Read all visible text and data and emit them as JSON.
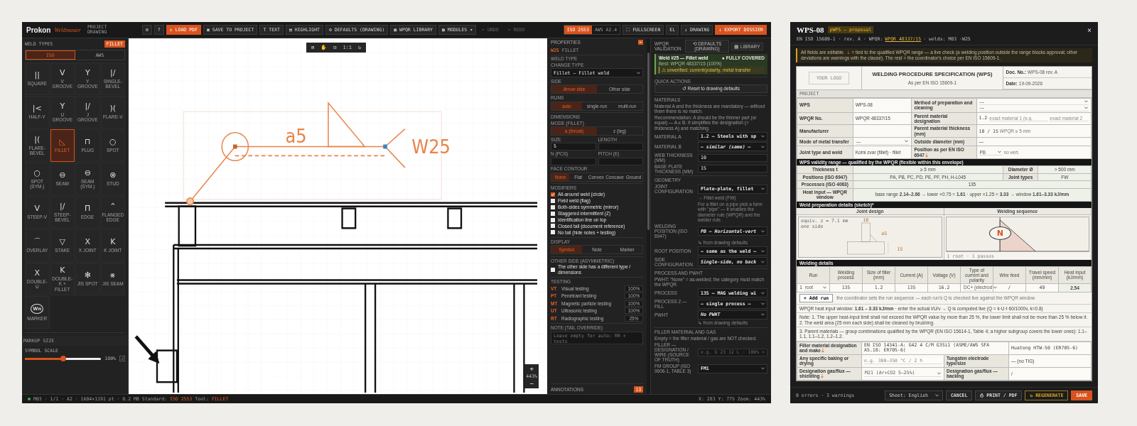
{
  "toolbar": {
    "brand": "Prokon",
    "product": "Weldmaster",
    "project_lines": [
      "PROJECT",
      "DRAWING"
    ],
    "buttons": [
      {
        "label": "⚙",
        "kind": "plain",
        "disabled": false
      },
      {
        "label": "?",
        "kind": "plain",
        "disabled": false
      },
      {
        "label": "↥ LOAD PDF",
        "kind": "accent",
        "disabled": false
      },
      {
        "label": "▣ SAVE TO PROJECT",
        "kind": "plain",
        "disabled": false
      },
      {
        "label": "T TEXT",
        "kind": "plain",
        "disabled": false
      },
      {
        "label": "▤ HIGHLIGHT",
        "kind": "plain",
        "disabled": false
      },
      {
        "label": "⚙ DEFAULTS (DRAWING)",
        "kind": "plain",
        "disabled": false
      },
      {
        "label": "▦ WPQR LIBRARY",
        "kind": "plain",
        "disabled": false
      },
      {
        "label": "▦ MODULES ▾",
        "kind": "plain",
        "disabled": false
      },
      {
        "label": "↶ UNDO",
        "kind": "plain",
        "disabled": true
      },
      {
        "label": "↷ REDO",
        "kind": "plain",
        "disabled": true
      }
    ],
    "standards": [
      {
        "label": "ISO 2553",
        "selected": true
      },
      {
        "label": "AWS A2.4",
        "selected": false
      }
    ],
    "right_buttons": [
      {
        "label": "⛶ FULLSCREEN",
        "kind": "plain"
      },
      {
        "label": "EL",
        "kind": "plain"
      },
      {
        "label": "↓ DRAWING",
        "kind": "plain"
      },
      {
        "label": "↓ EXPORT DOSSIER",
        "kind": "accent"
      }
    ]
  },
  "weld_types": {
    "title": "WELD TYPES",
    "badge": "FILLET",
    "tabs": [
      {
        "label": "ISO",
        "selected": true
      },
      {
        "label": "AWS",
        "selected": false
      }
    ],
    "items": [
      {
        "symbol": "||",
        "label": "SQUARE",
        "selected": false
      },
      {
        "symbol": "V",
        "label": "V GROOVE",
        "selected": false
      },
      {
        "symbol": "Y",
        "label": "Y GROOVE",
        "selected": false
      },
      {
        "symbol": "|/",
        "label": "SINGLE-BEVEL",
        "selected": false
      },
      {
        "symbol": "|<",
        "label": "HALF-Y",
        "selected": false
      },
      {
        "symbol": "Y",
        "label": "U GROOVE",
        "selected": false
      },
      {
        "symbol": "|/",
        "label": "J GROOVE",
        "selected": false
      },
      {
        "symbol": ")(",
        "label": "FLARE-V",
        "selected": false
      },
      {
        "symbol": "|(",
        "label": "FLARE-BEVEL",
        "selected": false
      },
      {
        "symbol": "◺",
        "label": "FILLET",
        "selected": true
      },
      {
        "symbol": "⊓",
        "label": "PLUG",
        "selected": false
      },
      {
        "symbol": "○",
        "label": "SPOT",
        "selected": false
      },
      {
        "symbol": "○",
        "label": "SPOT (SYM.)",
        "selected": false
      },
      {
        "symbol": "⊖",
        "label": "SEAM",
        "selected": false
      },
      {
        "symbol": "⊖",
        "label": "SEAM (SYM.)",
        "selected": false
      },
      {
        "symbol": "⊗",
        "label": "STUD",
        "selected": false
      },
      {
        "symbol": "V",
        "label": "STEEP-V",
        "selected": false
      },
      {
        "symbol": "|/",
        "label": "STEEP-BEVEL",
        "selected": false
      },
      {
        "symbol": "Π",
        "label": "EDGE",
        "selected": false
      },
      {
        "symbol": "⌃",
        "label": "FLANGED EDGE",
        "selected": false
      },
      {
        "symbol": "⌒",
        "label": "OVERLAY",
        "selected": false
      },
      {
        "symbol": "▽",
        "label": "STAKE",
        "selected": false
      },
      {
        "symbol": "X",
        "label": "X JOINT",
        "selected": false
      },
      {
        "symbol": "K",
        "label": "K JOINT",
        "selected": false
      },
      {
        "symbol": "X",
        "label": "DOUBLE-U",
        "selected": false
      },
      {
        "symbol": "K",
        "label": "DOUBLE-K + FILLET",
        "selected": false
      },
      {
        "symbol": "✻",
        "label": "JIS SPOT",
        "selected": false
      },
      {
        "symbol": "⨳",
        "label": "JIS SEAM",
        "selected": false
      },
      {
        "symbol": "Wn",
        "label": "MARKER",
        "selected": false
      }
    ],
    "markup": {
      "title": "MARKUP SIZE",
      "label": "SYMBOL SCALE",
      "level": 0.5,
      "reading": "100%"
    }
  },
  "canvas": {
    "tools": [
      "⊞",
      "✋",
      "⊡",
      "1:1",
      "↻"
    ],
    "throat": "a5",
    "weld_id": "W25",
    "zoom": [
      "+",
      "443%",
      "−"
    ]
  },
  "properties": {
    "title": "PROPERTIES",
    "weld_id": "W25",
    "weld_type": "FILLET",
    "items": [
      {
        "kind": "label",
        "text": "WELD TYPE"
      },
      {
        "kind": "label",
        "text": "CHANGE TYPE"
      },
      {
        "kind": "select",
        "value": "Fillet — Fillet weld"
      },
      {
        "kind": "label",
        "text": "SIDE"
      },
      {
        "kind": "segmented",
        "options": [
          {
            "label": "Arrow side",
            "selected": true
          },
          {
            "label": "Other side",
            "selected": false
          }
        ]
      },
      {
        "kind": "label",
        "text": "RUNS"
      },
      {
        "kind": "segmented",
        "options": [
          {
            "label": "auto",
            "selected": true
          },
          {
            "label": "single-run",
            "selected": false
          },
          {
            "label": "multi-run",
            "selected": false
          }
        ]
      },
      {
        "kind": "heading",
        "text": "DIMENSIONS"
      },
      {
        "kind": "label",
        "text": "MODE (FILLET)"
      },
      {
        "kind": "segmented",
        "options": [
          {
            "label": "a (throat)",
            "selected": true
          },
          {
            "label": "z (leg)",
            "selected": false
          }
        ]
      },
      {
        "kind": "fields",
        "fields": [
          {
            "label": "SIZE",
            "value": "5"
          },
          {
            "label": "LENGTH"
          }
        ]
      },
      {
        "kind": "fields",
        "fields": [
          {
            "label": "N (PCS)"
          },
          {
            "label": "PITCH (E)"
          }
        ]
      },
      {
        "kind": "label",
        "text": "FACE CONTOUR"
      },
      {
        "kind": "segmented",
        "options": [
          {
            "label": "None",
            "selected": true
          },
          {
            "label": "Flat",
            "selected": false
          },
          {
            "label": "Convex",
            "selected": false
          },
          {
            "label": "Concave",
            "selected": false
          },
          {
            "label": "Ground",
            "selected": false
          }
        ]
      },
      {
        "kind": "heading",
        "text": "MODIFIERS"
      },
      {
        "kind": "checkbox",
        "label": "All-around weld (circle)",
        "checked": true
      },
      {
        "kind": "checkbox",
        "label": "Field weld (flag)",
        "checked": false
      },
      {
        "kind": "checkbox",
        "label": "Both-sides symmetric (mirror)",
        "checked": false
      },
      {
        "kind": "checkbox",
        "label": "Staggered intermittent (Z)",
        "checked": false
      },
      {
        "kind": "checkbox",
        "label": "Identification line on top",
        "checked": false
      },
      {
        "kind": "checkbox",
        "label": "Closed tail (document reference)",
        "checked": false
      },
      {
        "kind": "checkbox",
        "label": "No tail (hide notes + testing)",
        "checked": false
      },
      {
        "kind": "heading",
        "text": "DISPLAY"
      },
      {
        "kind": "segmented",
        "options": [
          {
            "label": "Symbol",
            "selected": true
          },
          {
            "label": "Note",
            "selected": false
          },
          {
            "label": "Marker",
            "selected": false
          }
        ]
      },
      {
        "kind": "heading",
        "text": "OTHER SIDE (ASYMMETRIC)"
      },
      {
        "kind": "checkbox",
        "label": "The other side has a different type / dimensions",
        "checked": false
      },
      {
        "kind": "heading",
        "text": "TESTING"
      },
      {
        "kind": "test",
        "code": "VT",
        "label": "Visual testing",
        "value": "100%"
      },
      {
        "kind": "test",
        "code": "PT",
        "label": "Penetrant testing",
        "value": "100%"
      },
      {
        "kind": "test",
        "code": "MT",
        "label": "Magnetic particle testing",
        "value": "100%"
      },
      {
        "kind": "test",
        "code": "UT",
        "label": "Ultrasonic testing",
        "value": "100%"
      },
      {
        "kind": "test",
        "code": "RT",
        "label": "Radiographic testing",
        "value": "25%"
      },
      {
        "kind": "heading",
        "text": "NOTE (TAIL OVERRIDE)"
      },
      {
        "kind": "textarea",
        "placeholder": "Leave empty for auto: RR + tests"
      }
    ],
    "annotations": {
      "title": "ANNOTATIONS",
      "count": "13"
    }
  },
  "validation": {
    "title": "WPQR VALIDATION",
    "buttons": [
      "⟲ DEFAULTS (DRAWING)",
      "▦ LIBRARY"
    ],
    "card": {
      "title": "Weld #25 — Fillet weld",
      "status": "● FULLY COVERED",
      "best": "Best: WPQR 48337/15 (100%)",
      "warning": "⚠ unverified: current/polarity, metal transfer"
    },
    "items": [
      {
        "kind": "heading",
        "text": "QUICK ACTIONS"
      },
      {
        "kind": "button",
        "label": "↺ Reset to drawing defaults"
      },
      {
        "kind": "heading",
        "text": "MATERIALS"
      },
      {
        "kind": "note",
        "text": "Material A and the thickness are mandatory — without them there is no match."
      },
      {
        "kind": "note",
        "text": "Recommendation: A should be the thinner part (or equal) — A ≤ B. It simplifies the designation (= thickness A) and matching."
      },
      {
        "kind": "select",
        "label": "MATERIAL A",
        "value": "1.2 — Steels with sp",
        "inherited": false
      },
      {
        "kind": "select",
        "label": "MATERIAL B",
        "value": "— similar (same) —",
        "inherited": true
      },
      {
        "kind": "input",
        "label": "WEB THICKNESS (MM)",
        "value": "10"
      },
      {
        "kind": "input",
        "label": "BASE PLATE THICKNESS (MM)",
        "value": "15"
      },
      {
        "kind": "heading",
        "text": "GEOMETRY"
      },
      {
        "kind": "select",
        "label": "JOINT CONFIGURATION",
        "value": "Plate-plate, fillet",
        "inherited": false
      },
      {
        "kind": "hint",
        "text": "→ Fillet weld (FW)"
      },
      {
        "kind": "hint",
        "text": "For a fillet on a pipe pick a form with \"pipe\" — it enables the diameter rule (WPQR) and the welder rule."
      },
      {
        "kind": "select",
        "label": "WELDING POSITION (ISO 6947)",
        "value": "PB — Horizontal-vert",
        "inherited": true
      },
      {
        "kind": "hint",
        "text": "↳ from drawing defaults"
      },
      {
        "kind": "select",
        "label": "ROOT POSITION",
        "value": "— same as the weld —",
        "inherited": false
      },
      {
        "kind": "select",
        "label": "SIDE CONFIGURATION",
        "value": "Single-side, no back",
        "inherited": true
      },
      {
        "kind": "heading",
        "text": "PROCESS AND PWHT"
      },
      {
        "kind": "note",
        "text": "PWHT: \"None\" = as-welded; the category must match the WPQR."
      },
      {
        "kind": "select",
        "label": "PROCESS",
        "value": "135 — MAG welding wi",
        "inherited": false
      },
      {
        "kind": "select",
        "label": "PROCESS 2 — FILL",
        "value": "— single process —",
        "inherited": false
      },
      {
        "kind": "select",
        "label": "PWHT",
        "value": "No PWHT",
        "inherited": true
      },
      {
        "kind": "hint",
        "text": "↳ from drawing defaults"
      },
      {
        "kind": "heading",
        "text": "FILLER MATERIAL AND GAS"
      },
      {
        "kind": "note",
        "text": "Empty = the filler material / gas are NOT checked."
      },
      {
        "kind": "input",
        "label": "FILLER — DESIGNATION / WIRE (SOURCE OF TRUTH)",
        "placeholder": "e.g. G 23 12 L · 100% +"
      },
      {
        "kind": "select",
        "label": "FM GROUP (ISO 9606-1, TABLE 3)",
        "value": "FM1",
        "inherited": false
      }
    ]
  },
  "status_bar": {
    "connected": true,
    "file": "M03",
    "info": "· 1/1 · A2 · 1684×1191 pt · 0.2 MB",
    "standard_label": "Standard:",
    "standard": "ISO 2553",
    "tool_label": "Tool:",
    "tool": "FILLET",
    "coords": "X: 283   Y: 775   Zoom: 443%"
  },
  "dialog": {
    "title": "WPS-08",
    "badge": "pWPS — proposal",
    "close": "×",
    "meta": {
      "before": "EN ISO 15609-1 · rev. A · WPQR:",
      "link": "WPQR 48337/15",
      "after": "· welds: M03  ·W25"
    },
    "notice": {
      "before": "All fields are editable.",
      "mark": "⇣",
      "after": "= tied to the qualified WPQR range — a live check (a welding position outside the range blocks approval; other deviations are warnings with the clause). The rest = the coordinator's choice per EN ISO 15609-1."
    },
    "doc": {
      "logo": "YOUR LOGO",
      "title": "WELDING PROCEDURE SPECIFICATION (WPS)",
      "subtitle": "As per EN ISO 15609-1",
      "doc_no_label": "Doc. No.:",
      "doc_no": "WPS-08 rev. A",
      "date_label": "Date:",
      "date": "19-09-2026"
    },
    "project_label": "PROJECT",
    "project_rows": [
      {
        "cells": [
          {
            "kind": "label",
            "text": "WPS"
          },
          {
            "kind": "text",
            "text": "WPS-08"
          },
          {
            "kind": "label",
            "text": "Method of preparation and cleaning"
          },
          {
            "kind": "select_pair",
            "values": [
              "—",
              "—"
            ]
          }
        ]
      },
      {
        "cells": [
          {
            "kind": "label",
            "text": "WPQR No."
          },
          {
            "kind": "text",
            "text": "WPQR 48337/15"
          },
          {
            "kind": "label",
            "text": "Parent material designation"
          },
          {
            "kind": "material",
            "text": "1.2",
            "placeholders": [
              "exact material 1 (e.g.",
              "exact material 2"
            ]
          }
        ]
      },
      {
        "cells": [
          {
            "kind": "label",
            "text": "Manufacturer"
          },
          {
            "kind": "blank"
          },
          {
            "kind": "label",
            "text": "Parent material thickness (mm)"
          },
          {
            "kind": "note_value",
            "text": "10 / 15",
            "note": "WPQR ≥ 5 mm"
          }
        ]
      },
      {
        "cells": [
          {
            "kind": "label",
            "text": "Mode of metal transfer"
          },
          {
            "kind": "select",
            "text": "—"
          },
          {
            "kind": "label",
            "text": "Outside diameter (mm)"
          },
          {
            "kind": "text",
            "text": "—"
          }
        ]
      },
      {
        "cells": [
          {
            "kind": "label",
            "text": "Joint type and weld"
          },
          {
            "kind": "text",
            "text": "Kotni zvar (fillet) · fillet"
          },
          {
            "kind": "label",
            "text": "Position as per EN ISO 6947",
            "mark": "⇣"
          },
          {
            "kind": "select_note",
            "text": "PB",
            "note": "no vert."
          }
        ]
      }
    ],
    "validity_title": "WPS validity range — qualified by the WPQR (flexible within this envelope)",
    "validity_rows": [
      {
        "cells": [
          {
            "kind": "label",
            "text": "Thickness t"
          },
          {
            "kind": "text",
            "text": "≥ 5 mm"
          },
          {
            "kind": "label",
            "text": "Diameter Ø"
          },
          {
            "kind": "text",
            "text": "> 500 mm"
          }
        ]
      },
      {
        "cells": [
          {
            "kind": "label",
            "text": "Positions (ISO 6947)"
          },
          {
            "kind": "text",
            "text": "PA, PB, PC, PD, PE, PF, PH, H-L045"
          },
          {
            "kind": "label",
            "text": "Joint types"
          },
          {
            "kind": "text",
            "text": "FW"
          }
        ]
      },
      {
        "cells": [
          {
            "kind": "label",
            "text": "Processes (ISO 4063)"
          },
          {
            "kind": "text",
            "text": "135"
          }
        ]
      },
      {
        "cells": [
          {
            "kind": "label",
            "text": "Heat input — WPQR window"
          },
          {
            "kind": "text",
            "text": "base range **2.14–2.66** → lower ×0.75 = **1.61** · upper ×1.25 = **3.33** → window **1.61–3.33 kJ/mm**"
          }
        ]
      }
    ],
    "sketch_title": "Weld preparation details (sketch)*",
    "sketch": {
      "joint_title": "Joint design",
      "sequence_title": "Welding sequence",
      "equiv": "equiv. z = 7.1 mm",
      "side": "one side",
      "web": "10",
      "throat": "a5",
      "plate": "15",
      "run_mark": "N",
      "caption": "1 root · 1 passes"
    },
    "details_title": "Welding details",
    "details_columns": [
      "Run",
      "Welding process",
      "Size of filler (mm)",
      "Current (A)",
      "Voltage (V)",
      "Type of current and polarity",
      "Wire feed",
      "Travel speed (mm/min)",
      "Heat input (kJ/mm)"
    ],
    "details_rows": [
      {
        "cells": [
          {
            "kind": "run",
            "text": "1",
            "value": "root"
          },
          {
            "kind": "text",
            "text": "135"
          },
          {
            "kind": "text",
            "text": "1.2"
          },
          {
            "kind": "text",
            "text": "135"
          },
          {
            "kind": "text",
            "text": "16.2"
          },
          {
            "kind": "select",
            "text": "DC+ (electrod"
          },
          {
            "kind": "text",
            "text": "/"
          },
          {
            "kind": "text",
            "text": "49"
          },
          {
            "kind": "computed",
            "text": "2.54"
          }
        ]
      }
    ],
    "add_run": "+ Add run",
    "add_run_note": "the coordinator sets the run sequence — each run's Q is checked live against the WPQR window",
    "notes": [
      "WPQR heat input window: **1.61 – 3.33 kJ/mm** · enter the actual I/U/v → Q is computed live (Q = k·U·I·60/1000v, k=0.8)",
      "Note: 1. The upper heat-input limit shall not exceed the WPQR value by more than 25 %, the lower limit shall not be more than 25 % below it. 2. The weld area (25 mm each side) shall be cleaned by brushing.",
      "3. Parent materials — group combinations qualified by the WPQR (EN ISO 15614-1, Table 4; a higher subgroup covers the lower ones): 1.1–1.1, 1.1–1.2, 1.2–1.2."
    ],
    "filler_rows": [
      {
        "cells": [
          {
            "kind": "label",
            "text": "Filler material designation and make",
            "mark": "⇣"
          },
          {
            "kind": "input",
            "text": "EN ISO 14341-A: G42 4 C/M G3Si1 (ASME/AWS SFA A5.18: ER70S-6)"
          },
          {
            "kind": "input",
            "text": "Huatong HTW-50 (ER70S-6)"
          }
        ]
      },
      {
        "cells": [
          {
            "kind": "label",
            "text": "Any specific baking or drying"
          },
          {
            "kind": "placeholder",
            "placeholder": "e.g. 300–350 °C / 2 h"
          },
          {
            "kind": "label",
            "text": "Tungsten electrode type/size"
          },
          {
            "kind": "text",
            "text": "— (no TIG)"
          }
        ]
      },
      {
        "cells": [
          {
            "kind": "label",
            "text": "Designation gas/flux — shielding",
            "mark": "⇣"
          },
          {
            "kind": "select",
            "text": "M21 (Ar+CO2 5–25%)"
          },
          {
            "kind": "label",
            "text": "Designation gas/flux — backing"
          },
          {
            "kind": "text",
            "text": "/"
          }
        ]
      }
    ],
    "footer": {
      "summary": "0 errors · 3 warnings",
      "sheet": "Sheet: English",
      "buttons": [
        {
          "label": "CANCEL",
          "kind": "plain"
        },
        {
          "label": "⎙ PRINT / PDF",
          "kind": "plain"
        },
        {
          "label": "↻ REGENERATE",
          "kind": "outline"
        },
        {
          "label": "SAVE",
          "kind": "accent"
        }
      ]
    }
  }
}
